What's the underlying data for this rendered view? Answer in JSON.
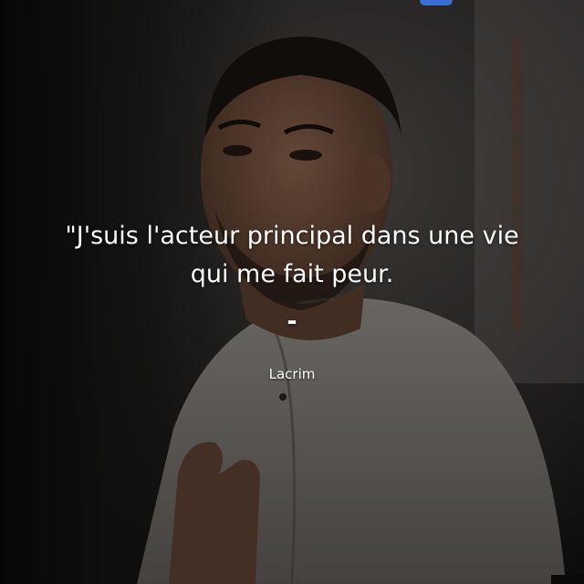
{
  "quote": {
    "line1": "\"J'suis l'acteur principal dans une vie",
    "line2": "qui me fait peur.",
    "separator": "-"
  },
  "author": "Lacrim",
  "colors": {
    "text": "#ffffff",
    "accent_glow": "#3b6fd4"
  },
  "icons": [
    "top-blue-badge-icon",
    "corner-logo-icon"
  ]
}
